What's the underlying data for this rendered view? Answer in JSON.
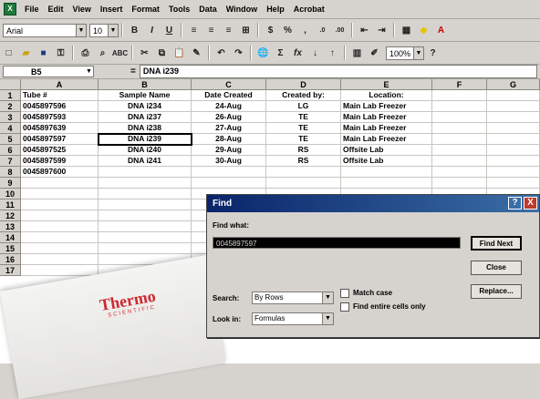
{
  "menu": [
    "File",
    "Edit",
    "View",
    "Insert",
    "Format",
    "Tools",
    "Data",
    "Window",
    "Help",
    "Acrobat"
  ],
  "toolbar": {
    "font_name": "Arial",
    "font_size": "10",
    "zoom": "100%"
  },
  "formula_bar": {
    "name_box": "B5",
    "fx": "=",
    "formula": "DNA i239"
  },
  "columns": [
    "A",
    "B",
    "C",
    "D",
    "E",
    "F",
    "G"
  ],
  "rows": [
    "1",
    "2",
    "3",
    "4",
    "5",
    "6",
    "7",
    "8",
    "9",
    "10",
    "11",
    "12",
    "13",
    "14",
    "15",
    "16",
    "17"
  ],
  "table": {
    "headers": [
      "Tube #",
      "Sample Name",
      "Date Created",
      "Created by:",
      "Location:"
    ],
    "data": [
      [
        "0045897596",
        "DNA i234",
        "24-Aug",
        "LG",
        "Main Lab Freezer"
      ],
      [
        "0045897593",
        "DNA i237",
        "26-Aug",
        "TE",
        "Main Lab Freezer"
      ],
      [
        "0045897639",
        "DNA i238",
        "27-Aug",
        "TE",
        "Main Lab Freezer"
      ],
      [
        "0045897597",
        "DNA i239",
        "28-Aug",
        "TE",
        "Main Lab Freezer"
      ],
      [
        "0045897525",
        "DNA i240",
        "29-Aug",
        "RS",
        "Offsite Lab"
      ],
      [
        "0045897599",
        "DNA i241",
        "30-Aug",
        "RS",
        "Offsite Lab"
      ],
      [
        "0045897600",
        "",
        "",
        "",
        ""
      ]
    ]
  },
  "find_dialog": {
    "title": "Find",
    "find_what_label": "Find what:",
    "find_what_value": "0045897597",
    "find_next": "Find Next",
    "close": "Close",
    "replace": "Replace...",
    "search_label": "Search:",
    "search_value": "By Rows",
    "lookin_label": "Look in:",
    "lookin_value": "Formulas",
    "match_case": "Match case",
    "entire_cells": "Find entire cells only",
    "help_btn": "?",
    "close_btn": "X"
  },
  "photo": {
    "brand": "Thermo",
    "sub": "SCIENTIFIC"
  }
}
